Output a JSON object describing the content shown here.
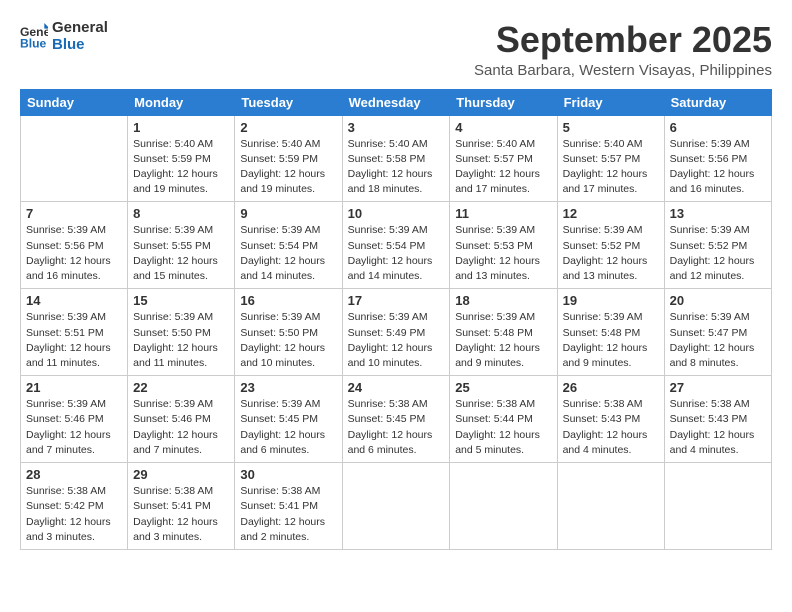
{
  "logo": {
    "line1": "General",
    "line2": "Blue"
  },
  "title": "September 2025",
  "subtitle": "Santa Barbara, Western Visayas, Philippines",
  "days_of_week": [
    "Sunday",
    "Monday",
    "Tuesday",
    "Wednesday",
    "Thursday",
    "Friday",
    "Saturday"
  ],
  "weeks": [
    [
      {
        "num": "",
        "info": ""
      },
      {
        "num": "1",
        "info": "Sunrise: 5:40 AM\nSunset: 5:59 PM\nDaylight: 12 hours\nand 19 minutes."
      },
      {
        "num": "2",
        "info": "Sunrise: 5:40 AM\nSunset: 5:59 PM\nDaylight: 12 hours\nand 19 minutes."
      },
      {
        "num": "3",
        "info": "Sunrise: 5:40 AM\nSunset: 5:58 PM\nDaylight: 12 hours\nand 18 minutes."
      },
      {
        "num": "4",
        "info": "Sunrise: 5:40 AM\nSunset: 5:57 PM\nDaylight: 12 hours\nand 17 minutes."
      },
      {
        "num": "5",
        "info": "Sunrise: 5:40 AM\nSunset: 5:57 PM\nDaylight: 12 hours\nand 17 minutes."
      },
      {
        "num": "6",
        "info": "Sunrise: 5:39 AM\nSunset: 5:56 PM\nDaylight: 12 hours\nand 16 minutes."
      }
    ],
    [
      {
        "num": "7",
        "info": "Sunrise: 5:39 AM\nSunset: 5:56 PM\nDaylight: 12 hours\nand 16 minutes."
      },
      {
        "num": "8",
        "info": "Sunrise: 5:39 AM\nSunset: 5:55 PM\nDaylight: 12 hours\nand 15 minutes."
      },
      {
        "num": "9",
        "info": "Sunrise: 5:39 AM\nSunset: 5:54 PM\nDaylight: 12 hours\nand 14 minutes."
      },
      {
        "num": "10",
        "info": "Sunrise: 5:39 AM\nSunset: 5:54 PM\nDaylight: 12 hours\nand 14 minutes."
      },
      {
        "num": "11",
        "info": "Sunrise: 5:39 AM\nSunset: 5:53 PM\nDaylight: 12 hours\nand 13 minutes."
      },
      {
        "num": "12",
        "info": "Sunrise: 5:39 AM\nSunset: 5:52 PM\nDaylight: 12 hours\nand 13 minutes."
      },
      {
        "num": "13",
        "info": "Sunrise: 5:39 AM\nSunset: 5:52 PM\nDaylight: 12 hours\nand 12 minutes."
      }
    ],
    [
      {
        "num": "14",
        "info": "Sunrise: 5:39 AM\nSunset: 5:51 PM\nDaylight: 12 hours\nand 11 minutes."
      },
      {
        "num": "15",
        "info": "Sunrise: 5:39 AM\nSunset: 5:50 PM\nDaylight: 12 hours\nand 11 minutes."
      },
      {
        "num": "16",
        "info": "Sunrise: 5:39 AM\nSunset: 5:50 PM\nDaylight: 12 hours\nand 10 minutes."
      },
      {
        "num": "17",
        "info": "Sunrise: 5:39 AM\nSunset: 5:49 PM\nDaylight: 12 hours\nand 10 minutes."
      },
      {
        "num": "18",
        "info": "Sunrise: 5:39 AM\nSunset: 5:48 PM\nDaylight: 12 hours\nand 9 minutes."
      },
      {
        "num": "19",
        "info": "Sunrise: 5:39 AM\nSunset: 5:48 PM\nDaylight: 12 hours\nand 9 minutes."
      },
      {
        "num": "20",
        "info": "Sunrise: 5:39 AM\nSunset: 5:47 PM\nDaylight: 12 hours\nand 8 minutes."
      }
    ],
    [
      {
        "num": "21",
        "info": "Sunrise: 5:39 AM\nSunset: 5:46 PM\nDaylight: 12 hours\nand 7 minutes."
      },
      {
        "num": "22",
        "info": "Sunrise: 5:39 AM\nSunset: 5:46 PM\nDaylight: 12 hours\nand 7 minutes."
      },
      {
        "num": "23",
        "info": "Sunrise: 5:39 AM\nSunset: 5:45 PM\nDaylight: 12 hours\nand 6 minutes."
      },
      {
        "num": "24",
        "info": "Sunrise: 5:38 AM\nSunset: 5:45 PM\nDaylight: 12 hours\nand 6 minutes."
      },
      {
        "num": "25",
        "info": "Sunrise: 5:38 AM\nSunset: 5:44 PM\nDaylight: 12 hours\nand 5 minutes."
      },
      {
        "num": "26",
        "info": "Sunrise: 5:38 AM\nSunset: 5:43 PM\nDaylight: 12 hours\nand 4 minutes."
      },
      {
        "num": "27",
        "info": "Sunrise: 5:38 AM\nSunset: 5:43 PM\nDaylight: 12 hours\nand 4 minutes."
      }
    ],
    [
      {
        "num": "28",
        "info": "Sunrise: 5:38 AM\nSunset: 5:42 PM\nDaylight: 12 hours\nand 3 minutes."
      },
      {
        "num": "29",
        "info": "Sunrise: 5:38 AM\nSunset: 5:41 PM\nDaylight: 12 hours\nand 3 minutes."
      },
      {
        "num": "30",
        "info": "Sunrise: 5:38 AM\nSunset: 5:41 PM\nDaylight: 12 hours\nand 2 minutes."
      },
      {
        "num": "",
        "info": ""
      },
      {
        "num": "",
        "info": ""
      },
      {
        "num": "",
        "info": ""
      },
      {
        "num": "",
        "info": ""
      }
    ]
  ]
}
